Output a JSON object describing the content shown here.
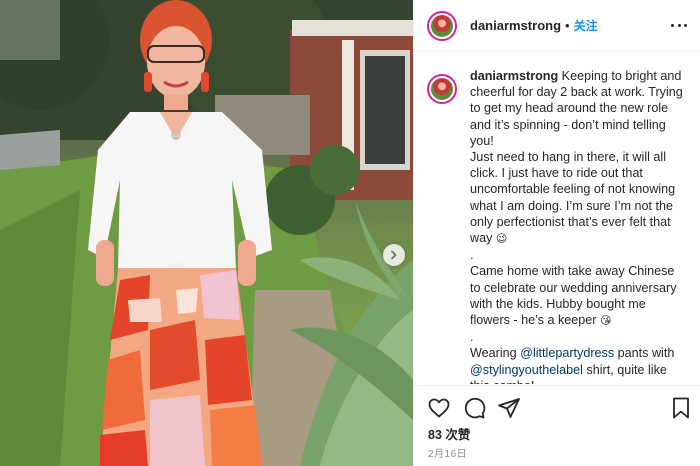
{
  "photo": {
    "alt_icon": "chevron-right-icon"
  },
  "header": {
    "username": "daniarmstrong",
    "separator": "•",
    "follow_label": "关注",
    "more_icon": "more-options-icon"
  },
  "caption": {
    "username": "daniarmstrong",
    "line1": "Keeping to bright and cheerful for day 2 back at work. Trying to get my head around the new role and it’s spinning - don’t mind telling you!",
    "line2": "Just need to hang in there, it will all click. I just have to ride out that uncomfortable feeling of not knowing what I am doing. I’m sure I’m not the only perfectionist that’s ever felt that way",
    "emoji1": "😉",
    "dot1": ".",
    "line3": "Came home with take away Chinese to celebrate our wedding anniversary with the kids. Hubby bought me flowers - he’s a keeper",
    "emoji2": "😘",
    "dot2": ".",
    "line4_prefix": "Wearing",
    "mention1": "@littlepartydress",
    "line4_mid": "pants with",
    "mention2": "@stylingyouthelabel",
    "line4_suffix": "shirt, quite like this combo!"
  },
  "actions": {
    "like_icon": "heart-icon",
    "comment_icon": "comment-icon",
    "share_icon": "share-icon",
    "save_icon": "bookmark-icon"
  },
  "likes": "83 次赞",
  "date": "2月16日",
  "colors": {
    "follow_blue": "#0095f6",
    "mention_blue": "#00376b",
    "text": "#262626",
    "muted": "#8e8e8e"
  }
}
